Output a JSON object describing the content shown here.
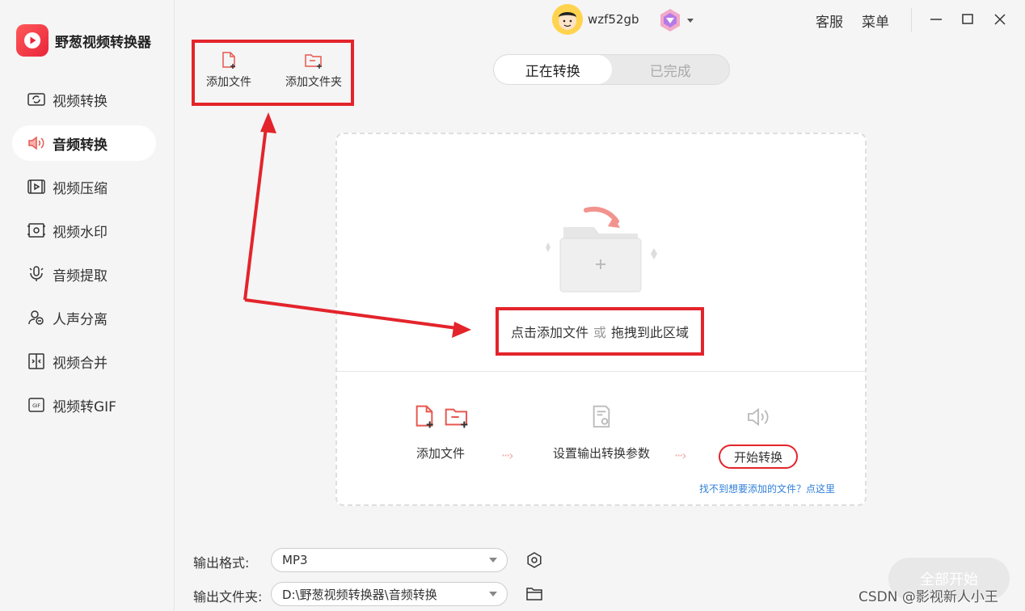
{
  "app": {
    "title": "野葱视频转换器"
  },
  "sidebar": {
    "items": [
      {
        "label": "视频转换",
        "icon": "video-convert-icon"
      },
      {
        "label": "音频转换",
        "icon": "audio-convert-icon",
        "active": true
      },
      {
        "label": "视频压缩",
        "icon": "video-compress-icon"
      },
      {
        "label": "视频水印",
        "icon": "video-watermark-icon"
      },
      {
        "label": "音频提取",
        "icon": "audio-extract-icon"
      },
      {
        "label": "人声分离",
        "icon": "vocal-separate-icon"
      },
      {
        "label": "视频合并",
        "icon": "video-merge-icon"
      },
      {
        "label": "视频转GIF",
        "icon": "video-to-gif-icon"
      }
    ]
  },
  "header": {
    "username": "wzf52gb",
    "service": "客服",
    "menu": "菜单"
  },
  "toolbar": {
    "add_file": "添加文件",
    "add_folder": "添加文件夹"
  },
  "tabs": [
    {
      "label": "正在转换",
      "active": true
    },
    {
      "label": "已完成",
      "active": false
    }
  ],
  "dropzone": {
    "click_text": "点击添加文件",
    "or_text": "或",
    "drag_text": "拖拽到此区域",
    "steps": {
      "add_file": "添加文件",
      "set_params": "设置输出转换参数",
      "start": "开始转换"
    },
    "help_link": "找不到想要添加的文件？点这里"
  },
  "settings": {
    "format_label": "输出格式:",
    "format_value": "MP3",
    "folder_label": "输出文件夹:",
    "folder_value": "D:\\野葱视频转换器\\音频转换"
  },
  "start_all": "全部开始",
  "watermark": "CSDN @影视新人小王",
  "colors": {
    "accent": "#e3242b",
    "annotation": "#e3242b"
  }
}
